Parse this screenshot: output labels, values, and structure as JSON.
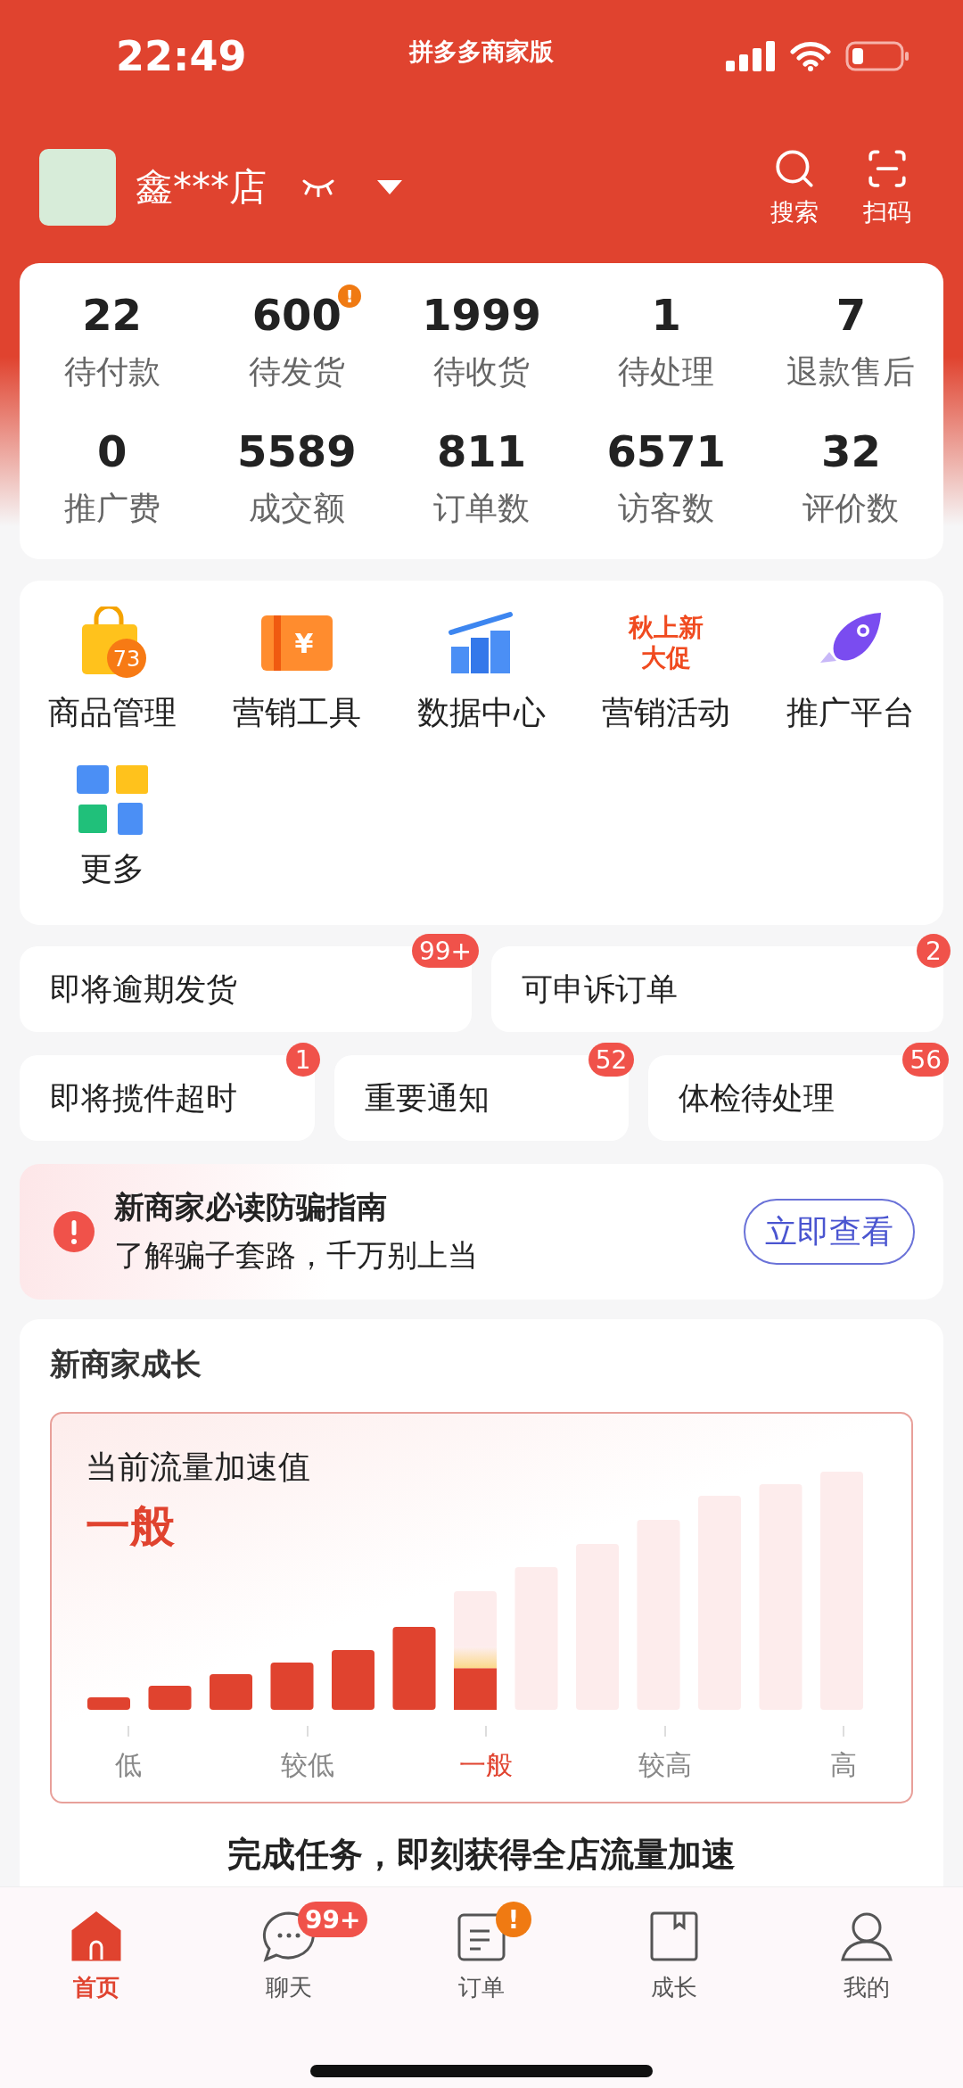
{
  "status_bar": {
    "time": "22:49",
    "app_title": "拼多多商家版"
  },
  "shop": {
    "name": "鑫***店"
  },
  "header_actions": [
    {
      "kind": "search",
      "label": "搜索"
    },
    {
      "kind": "scan",
      "label": "扫码"
    }
  ],
  "stats": [
    {
      "value": "22",
      "label": "待付款"
    },
    {
      "value": "600",
      "label": "待发货",
      "badge": "!"
    },
    {
      "value": "1999",
      "label": "待收货"
    },
    {
      "value": "1",
      "label": "待处理"
    },
    {
      "value": "7",
      "label": "退款售后"
    },
    {
      "value": "0",
      "label": "推广费"
    },
    {
      "value": "5589",
      "label": "成交额"
    },
    {
      "value": "811",
      "label": "订单数"
    },
    {
      "value": "6571",
      "label": "访客数"
    },
    {
      "value": "32",
      "label": "评价数"
    }
  ],
  "tools": [
    {
      "kind": "bag",
      "label": "商品管理",
      "icon_text": "73"
    },
    {
      "kind": "ticket",
      "label": "营销工具",
      "icon_text": "¥"
    },
    {
      "kind": "chart",
      "label": "数据中心"
    },
    {
      "kind": "promo",
      "label": "营销活动",
      "icon_lines": [
        "秋上新",
        "大促"
      ]
    },
    {
      "kind": "rocket",
      "label": "推广平台"
    },
    {
      "kind": "more",
      "label": "更多"
    }
  ],
  "task_rows": [
    [
      {
        "label": "即将逾期发货",
        "badge": "99+"
      },
      {
        "label": "可申诉订单",
        "badge": "2"
      }
    ],
    [
      {
        "label": "即将揽件超时",
        "badge": "1"
      },
      {
        "label": "重要通知",
        "badge": "52"
      },
      {
        "label": "体检待处理",
        "badge": "56"
      }
    ]
  ],
  "notice": {
    "title": "新商家必读防骗指南",
    "subtitle": "了解骗子套路，千万别上当",
    "button": "立即查看"
  },
  "growth": {
    "title": "新商家成长",
    "gauge_title": "当前流量加速值",
    "gauge_value": "一般",
    "level": 0.5,
    "scale": [
      {
        "label": "低",
        "selected": false
      },
      {
        "label": "较低",
        "selected": false
      },
      {
        "label": "一般",
        "selected": true
      },
      {
        "label": "较高",
        "selected": false
      },
      {
        "label": "高",
        "selected": false
      }
    ],
    "footer_text": "完成任务，即刻获得全店流量加速"
  },
  "tabbar": [
    {
      "kind": "home",
      "label": "首页",
      "selected": true
    },
    {
      "kind": "chat",
      "label": "聊天",
      "selected": false,
      "badge": "99+"
    },
    {
      "kind": "order",
      "label": "订单",
      "selected": false,
      "badge": "!"
    },
    {
      "kind": "growth",
      "label": "成长",
      "selected": false
    },
    {
      "kind": "me",
      "label": "我的",
      "selected": false
    }
  ]
}
